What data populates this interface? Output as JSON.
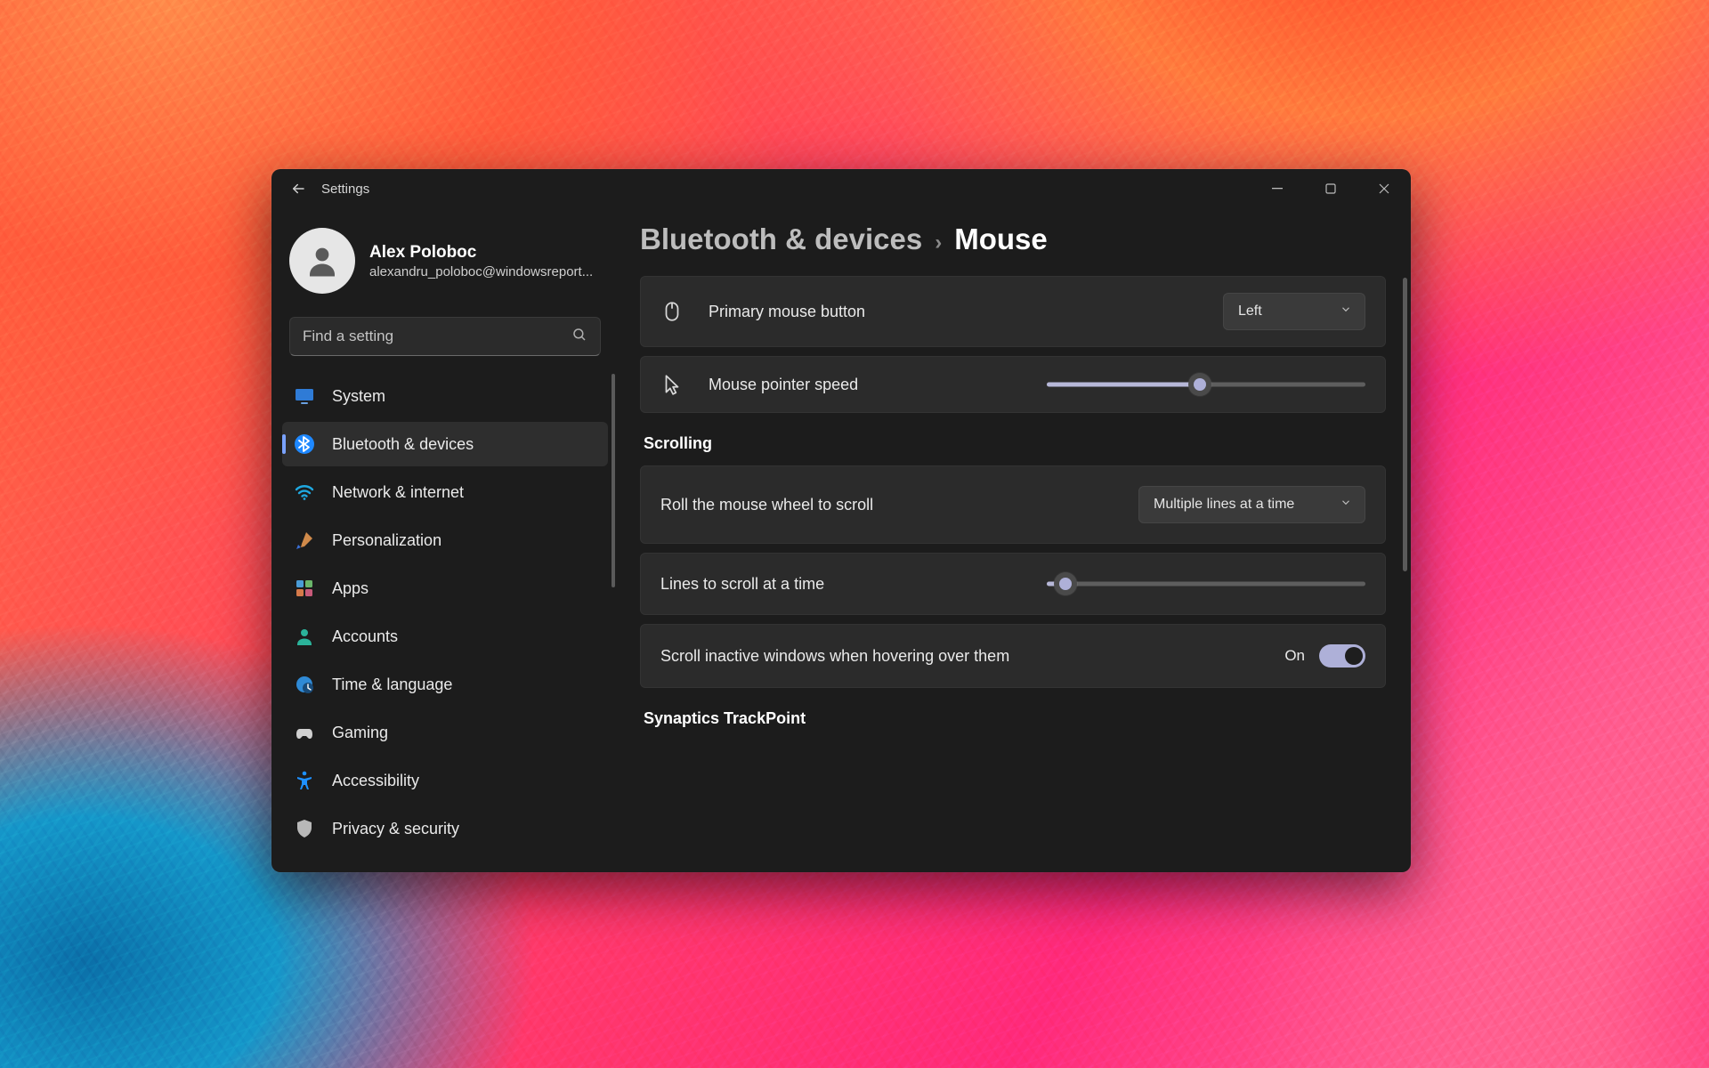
{
  "window": {
    "title": "Settings"
  },
  "user": {
    "display_name": "Alex Poloboc",
    "email": "alexandru_poloboc@windowsreport..."
  },
  "search": {
    "placeholder": "Find a setting"
  },
  "sidebar": {
    "items": [
      {
        "label": "System",
        "icon": "system"
      },
      {
        "label": "Bluetooth & devices",
        "icon": "bluetooth",
        "active": true
      },
      {
        "label": "Network & internet",
        "icon": "wifi"
      },
      {
        "label": "Personalization",
        "icon": "brush"
      },
      {
        "label": "Apps",
        "icon": "apps"
      },
      {
        "label": "Accounts",
        "icon": "person"
      },
      {
        "label": "Time & language",
        "icon": "clock-globe"
      },
      {
        "label": "Gaming",
        "icon": "gamepad"
      },
      {
        "label": "Accessibility",
        "icon": "accessibility"
      },
      {
        "label": "Privacy & security",
        "icon": "shield"
      }
    ]
  },
  "breadcrumb": {
    "parent": "Bluetooth & devices",
    "current": "Mouse"
  },
  "settings": {
    "primary_button": {
      "label": "Primary mouse button",
      "value": "Left"
    },
    "pointer_speed": {
      "label": "Mouse pointer speed",
      "percent": 48
    },
    "section_scrolling": "Scrolling",
    "wheel_mode": {
      "label": "Roll the mouse wheel to scroll",
      "value": "Multiple lines at a time"
    },
    "lines": {
      "label": "Lines to scroll at a time",
      "percent": 6
    },
    "inactive": {
      "label": "Scroll inactive windows when hovering over them",
      "state": "On",
      "on": true
    },
    "section_trackpoint": "Synaptics TrackPoint"
  }
}
